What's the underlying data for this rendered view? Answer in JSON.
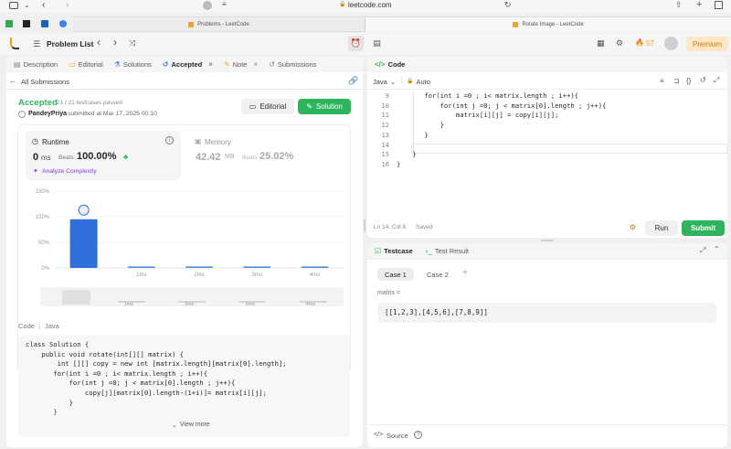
{
  "browser": {
    "url": "leetcode.com",
    "tabs": [
      {
        "title": "Problems - LeetCode"
      },
      {
        "title": "Rotate Image - LeetCode"
      }
    ]
  },
  "appbar": {
    "problem_list": "Problem List",
    "streak": "57",
    "premium": "Premium"
  },
  "left_tabs": [
    "Description",
    "Editorial",
    "Solutions",
    "Accepted",
    "Note",
    "Submissions"
  ],
  "submissions_link": "All Submissions",
  "result": {
    "status": "Accepted",
    "testcases": "21 / 21 testcases passed",
    "user": "PandeyPriya",
    "submitted": "submitted at Mar 17, 2025 00:10",
    "editorial_btn": "Editorial",
    "solution_btn": "Solution"
  },
  "runtime": {
    "label": "Runtime",
    "value": "0",
    "unit": "ms",
    "beats_label": "Beats",
    "beats": "100.00%",
    "analyze": "Analyze Complexity"
  },
  "memory": {
    "label": "Memory",
    "value": "42.42",
    "unit": "MB",
    "beats_label": "Beats",
    "beats": "25.02%"
  },
  "chart_data": {
    "type": "bar",
    "categories": [
      "",
      "1ms",
      "2ms",
      "3ms",
      "4ms"
    ],
    "values": [
      95,
      3,
      3,
      3,
      3
    ],
    "yticks": [
      "150%",
      "100%",
      "50%",
      "0%"
    ],
    "ylim": [
      0,
      150
    ],
    "mini_labels": [
      "1ms",
      "2ms",
      "3ms",
      "4ms"
    ]
  },
  "code_section": {
    "label": "Code",
    "lang": "Java",
    "lines": [
      "class Solution {",
      "    public void rotate(int[][] matrix) {",
      "        int [][] copy = new int [matrix.length][matrix[0].length];",
      "       for(int i =0 ; i< matrix.length ; i++){",
      "           for(int j =0; j < matrix[0].length ; j++){",
      "               copy[j][matrix[0].length-(1+i)]= matrix[i][j];",
      "           }",
      "       }"
    ],
    "view_more": "View more"
  },
  "editor": {
    "title": "Code",
    "lang": "Java",
    "mode": "Auto",
    "lines": [
      {
        "n": "9",
        "t": "       for(int i =0 ; i< matrix.length ; i++){"
      },
      {
        "n": "10",
        "t": "           for(int j =0; j < matrix[0].length ; j++){"
      },
      {
        "n": "11",
        "t": "               matrix[i][j] = copy[i][j];"
      },
      {
        "n": "12",
        "t": "           }"
      },
      {
        "n": "13",
        "t": "       }"
      },
      {
        "n": "14",
        "t": ""
      },
      {
        "n": "15",
        "t": "    }"
      },
      {
        "n": "16",
        "t": "}"
      }
    ],
    "status": "Ln 14, Col 8",
    "saved": "Saved",
    "run": "Run",
    "submit": "Submit"
  },
  "testpanel": {
    "testcase_tab": "Testcase",
    "result_tab": "Test Result",
    "cases": [
      "Case 1",
      "Case 2"
    ],
    "var_label": "matrix =",
    "var_value": "[[1,2,3],[4,5,6],[7,8,9]]",
    "source": "Source"
  }
}
